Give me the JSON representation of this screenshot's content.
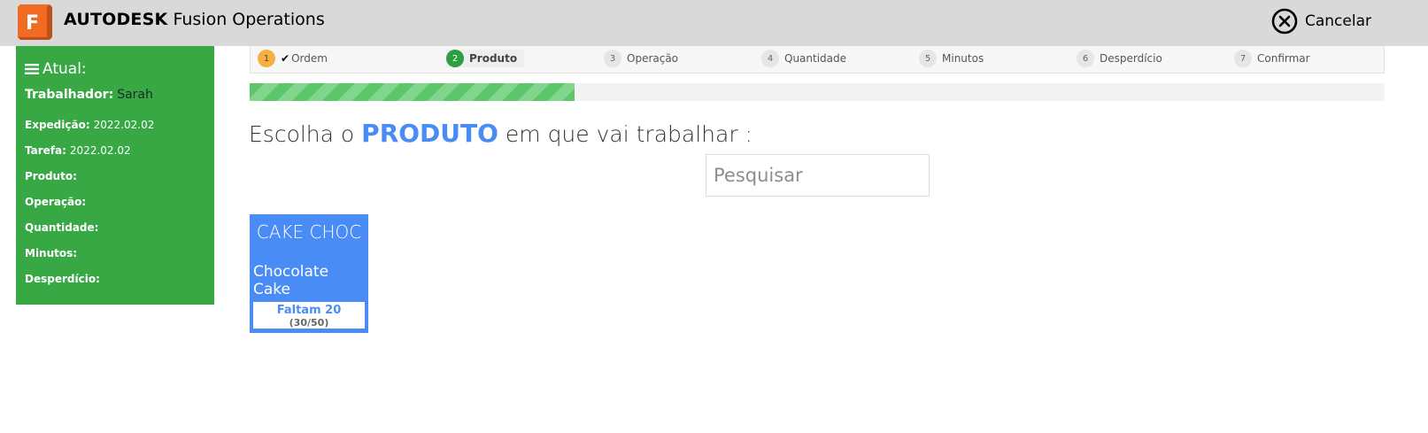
{
  "header": {
    "brand_bold": "AUTODESK",
    "brand_rest": " Fusion Operations",
    "logo_icon": "fusion-f-logo",
    "logo_letter": "F",
    "cancel_label": "Cancelar",
    "cancel_icon": "close-circle-icon"
  },
  "sidebar": {
    "title": "Atual:",
    "title_icon": "menu-icon",
    "worker_label": "Trabalhador:",
    "worker_value": "Sarah",
    "rows": [
      {
        "label": "Expedição:",
        "value": "2022.02.02"
      },
      {
        "label": "Tarefa:",
        "value": "2022.02.02"
      },
      {
        "label": "Produto:",
        "value": ""
      },
      {
        "label": "Operação:",
        "value": ""
      },
      {
        "label": "Quantidade:",
        "value": ""
      },
      {
        "label": "Minutos:",
        "value": ""
      },
      {
        "label": "Desperdício:",
        "value": ""
      }
    ]
  },
  "steps": [
    {
      "num": "1",
      "label": "Ordem",
      "state": "done"
    },
    {
      "num": "2",
      "label": "Produto",
      "state": "current"
    },
    {
      "num": "3",
      "label": "Operação",
      "state": "pending"
    },
    {
      "num": "4",
      "label": "Quantidade",
      "state": "pending"
    },
    {
      "num": "5",
      "label": "Minutos",
      "state": "pending"
    },
    {
      "num": "6",
      "label": "Desperdício",
      "state": "pending"
    },
    {
      "num": "7",
      "label": "Confirmar",
      "state": "pending"
    }
  ],
  "progress": {
    "fraction": 0.286
  },
  "main": {
    "heading_pre": "Escolha o ",
    "heading_highlight": "PRODUTO",
    "heading_post": " em que vai trabalhar :",
    "search_placeholder": "Pesquisar"
  },
  "products": [
    {
      "code": "CAKE CHOC",
      "name": "Chocolate Cake",
      "remaining": "Faltam 20",
      "progress": "(30/50)"
    }
  ],
  "colors": {
    "topbar": "#d9d9d9",
    "sidebar": "#38a845",
    "accent_blue": "#4a8cf5",
    "step_done": "#f5b041",
    "step_current": "#2e9e43",
    "progress_stripe": "#5cc66a"
  }
}
